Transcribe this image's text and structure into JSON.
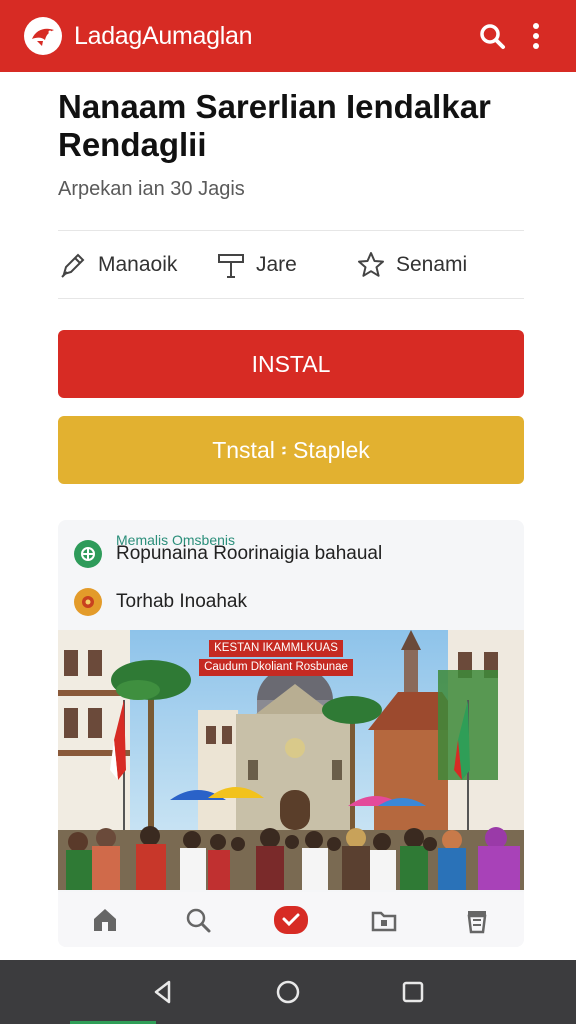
{
  "appbar": {
    "title": "LadagAumaglan",
    "logo_icon": "bird-logo-icon",
    "search_icon": "search-icon",
    "menu_icon": "more-vert-icon",
    "color": "#d72b24"
  },
  "header": {
    "title": "Nanaam Sarerlian Iendalkar Rendaglii",
    "subtitle": "Arpekan ian 30 Jagis"
  },
  "actions": [
    {
      "label": "Manaoik",
      "icon": "pencil-icon"
    },
    {
      "label": "Jare",
      "icon": "signpost-icon"
    },
    {
      "label": "Senami",
      "icon": "star-icon"
    }
  ],
  "buttons": {
    "install_label": "INSTAL",
    "install_color": "#d72b24",
    "secondary_label": "Tnstal ፡ Staplek",
    "secondary_color": "#e2b130"
  },
  "card": {
    "label": "Memalis Omsbenis",
    "rows": [
      {
        "text": "Ropunaina Roorinaigia bahaual",
        "icon": "green-emblem-icon"
      },
      {
        "text": "Torhab Inoahak",
        "icon": "orange-emblem-icon"
      }
    ],
    "banner_line1": "KESTAN IKAMMLKUAS",
    "banner_line2": "Caudum Dkoliant Rosbunae",
    "nav": [
      "home-icon",
      "search-icon",
      "check-icon",
      "folder-icon",
      "trash-icon"
    ]
  },
  "sysnav": [
    "back-icon",
    "home-circle-icon",
    "recents-icon"
  ]
}
